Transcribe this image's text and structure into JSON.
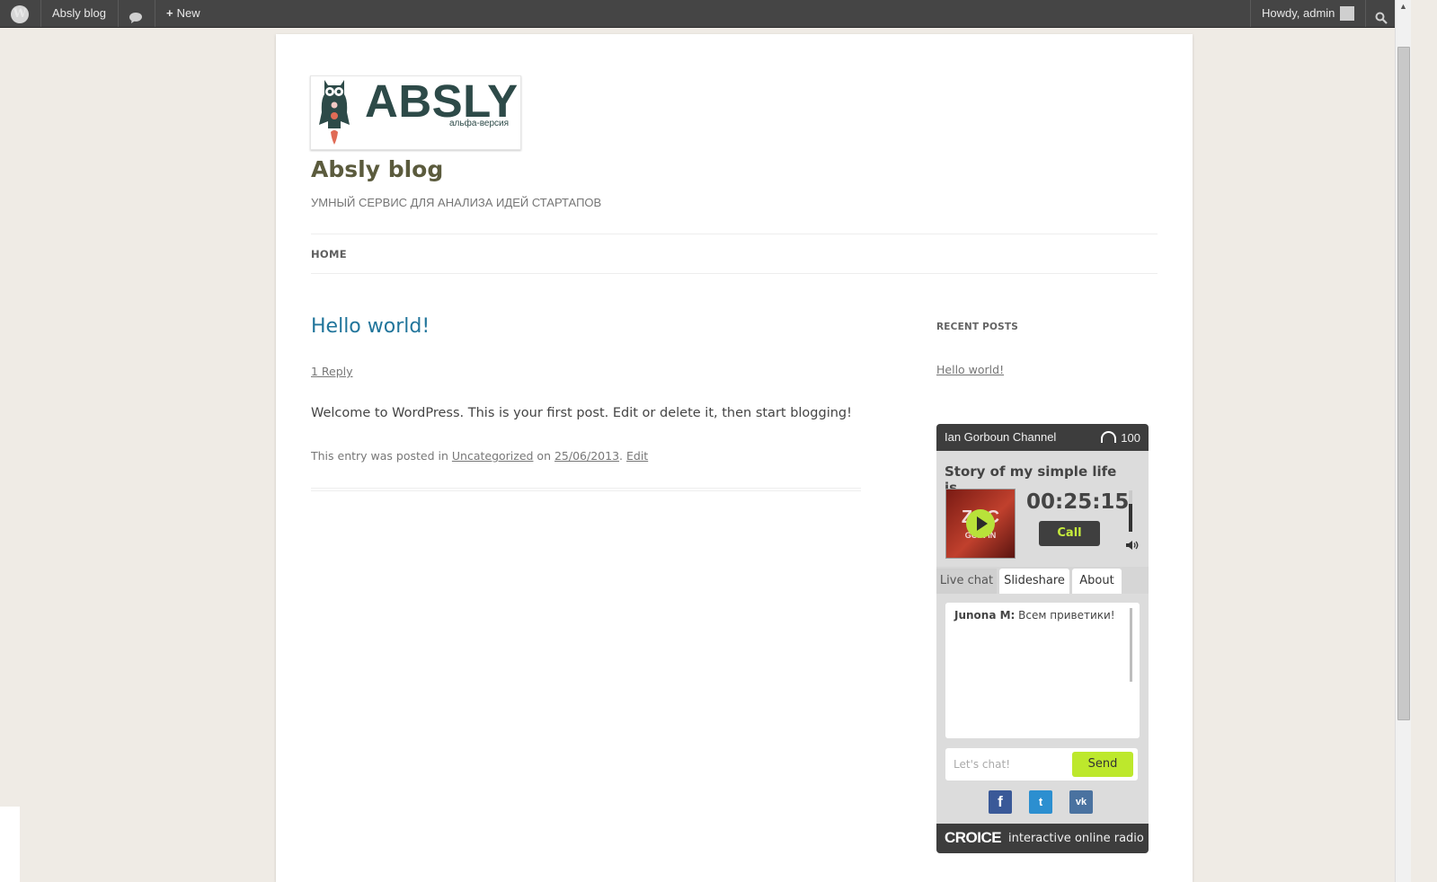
{
  "adminbar": {
    "logo_glyph": "W",
    "site_name": "Absly blog",
    "comments_icon": "comment-bubble-icon",
    "new_label": "New",
    "howdy": "Howdy, admin",
    "search_icon": "search-icon"
  },
  "header": {
    "logo_word": "ABSLY",
    "logo_sub": "альфа-версия",
    "site_title": "Absly blog",
    "tagline": "УМНЫЙ СЕРВИС ДЛЯ АНАЛИЗА ИДЕЙ СТАРТАПОВ"
  },
  "nav": {
    "home": "HOME"
  },
  "post": {
    "title": "Hello world!",
    "reply": "1 Reply",
    "content": "Welcome to WordPress. This is your first post. Edit or delete it, then start blogging!",
    "meta_prefix": "This entry was posted in ",
    "category": "Uncategorized",
    "meta_on": " on ",
    "date": "25/06/2013",
    "meta_sep": ". ",
    "edit": "Edit"
  },
  "sidebar": {
    "recent_title": "RECENT POSTS",
    "recent_link": "Hello world!"
  },
  "widget": {
    "channel": "Ian Gorboun Channel",
    "listeners": "100",
    "story": "Story of my simple life is...",
    "cover_text_top": "ZOC",
    "cover_text_bottom": "GOIN IN",
    "timer": "00:25:15",
    "call": "Call",
    "volume_level": 0.67,
    "tabs": [
      "Live chat",
      "Slideshare",
      "About"
    ],
    "chat_user": "Junona M:",
    "chat_message": " Всем приветики!",
    "chat_placeholder": "Let's chat!",
    "send": "Send",
    "social": {
      "facebook": "f",
      "twitter": "t",
      "vk": "vk"
    },
    "brand": "CROICE",
    "brand_tagline": "interactive online radio",
    "colors": {
      "accent": "#bde82c",
      "dark": "#3d3d3d"
    }
  }
}
